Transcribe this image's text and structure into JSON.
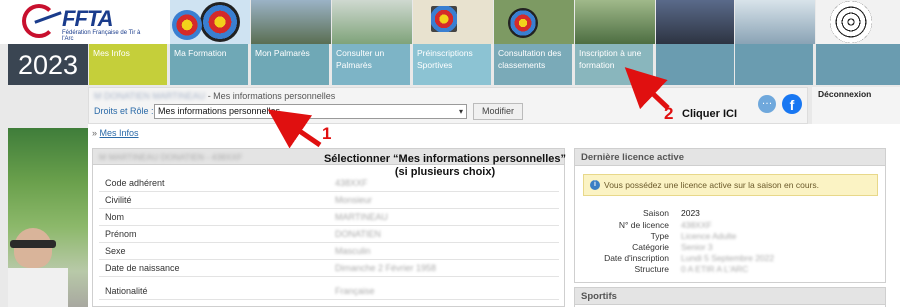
{
  "header": {
    "logo_text": "FFTA",
    "logo_subtitle": "Fédération Française de Tir à l'Arc",
    "year": "2023"
  },
  "menu": [
    {
      "label": "Mes Infos",
      "color": "#c5cf3a"
    },
    {
      "label": "Ma Formation",
      "color": "#6fa8b6"
    },
    {
      "label": "Mon Palmarès",
      "color": "#6fa8b6"
    },
    {
      "label": "Consulter un Palmarès",
      "color": "#7db4c6"
    },
    {
      "label": "Préinscriptions Sportives",
      "color": "#8cc3d3"
    },
    {
      "label": "Consultation des classements",
      "color": "#7aaab8"
    },
    {
      "label": "Inscription à une formation",
      "color": "#89b6bd"
    },
    {
      "label": "",
      "color": "#6a9cb0"
    },
    {
      "label": "",
      "color": "#6a9cb0"
    },
    {
      "label": "",
      "color": "#6a9cb0"
    }
  ],
  "selector": {
    "user_name": "M DONATIEN MARTINEAU",
    "page_suffix": " - Mes informations personnelles",
    "label": "Droits et Rôle :",
    "selected": "Mes informations personnelles",
    "modify_button": "Modifier",
    "logout": "Déconnexion",
    "chat_icon_glyph": "…",
    "facebook_glyph": "f"
  },
  "breadcrumb": {
    "separator": "»",
    "link": "Mes Infos"
  },
  "personal_info": {
    "header": "M MARTINEAU DONATIEN - 438XXF",
    "rows": [
      {
        "label": "Code adhérent",
        "value": "438XXF"
      },
      {
        "label": "Civilité",
        "value": "Monsieur"
      },
      {
        "label": "Nom",
        "value": "MARTINEAU"
      },
      {
        "label": "Prénom",
        "value": "DONATIEN"
      },
      {
        "label": "Sexe",
        "value": "Masculin"
      },
      {
        "label": "Date de naissance",
        "value": "Dimanche 2 Février 1958"
      },
      {
        "label": "Nationalité",
        "value": "Française"
      }
    ]
  },
  "licence": {
    "header": "Dernière licence active",
    "alert": "Vous possédez une licence active sur la saison en cours.",
    "alert_icon": "i",
    "rows": [
      {
        "label": "Saison",
        "value": "2023",
        "blurred": false
      },
      {
        "label": "N° de licence",
        "value": "438XXF",
        "blurred": true
      },
      {
        "label": "Type",
        "value": "Licence Adulte",
        "blurred": true
      },
      {
        "label": "Catégorie",
        "value": "Senior 3",
        "blurred": true
      },
      {
        "label": "Date d'inscription",
        "value": "Lundi 5 Septembre 2022",
        "blurred": true
      },
      {
        "label": "Structure",
        "value": "0 A ETIR A L'ARC",
        "blurred": true
      }
    ]
  },
  "sportifs": {
    "header": "Sportifs"
  },
  "annotations": {
    "step1_number": "1",
    "step1_text_line1": "Sélectionner “Mes informations personnelles”",
    "step1_text_line2": "(si plusieurs choix)",
    "step2_number": "2",
    "step2_text": "Cliquer ICI",
    "arrow_color": "#e01010"
  }
}
